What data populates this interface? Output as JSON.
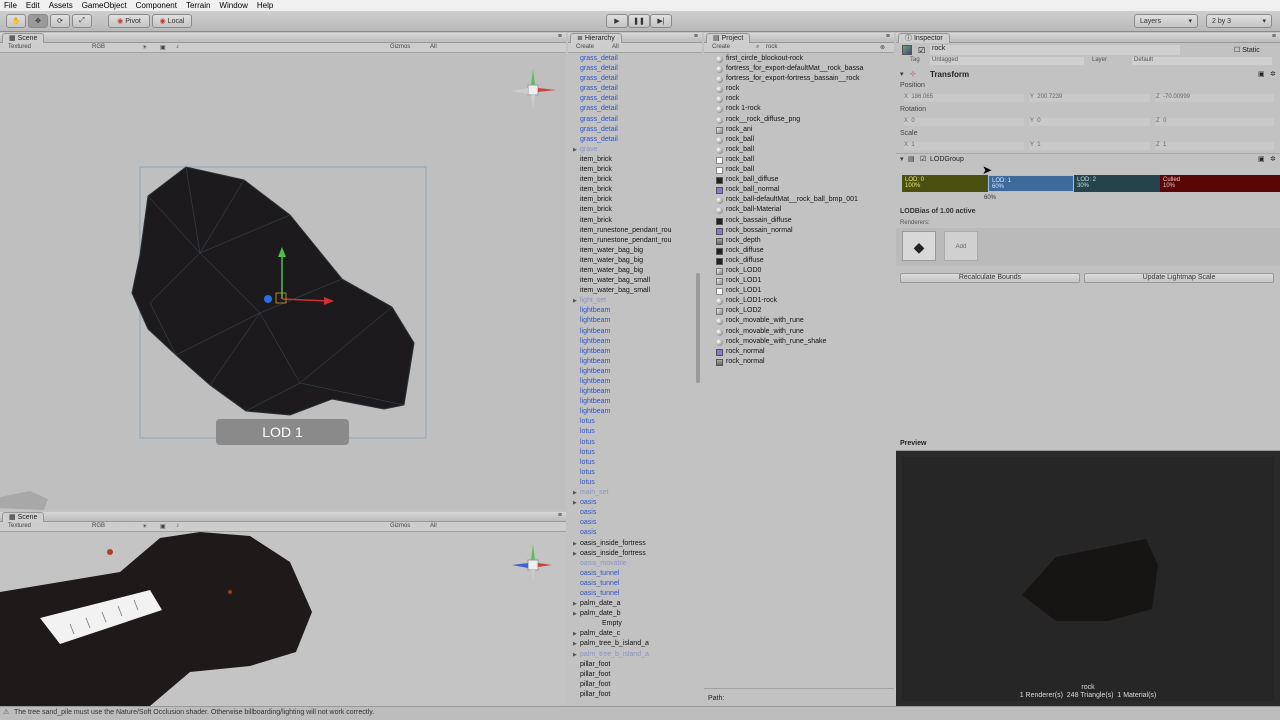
{
  "menubar": [
    "File",
    "Edit",
    "Assets",
    "GameObject",
    "Component",
    "Terrain",
    "Window",
    "Help"
  ],
  "toolbar": {
    "pivot": "Pivot",
    "local": "Local",
    "layers": "Layers",
    "layout": "2 by 3"
  },
  "scene_top": {
    "tab": "Scene",
    "shading": "Textured",
    "mode": "RGB",
    "gizmos": "Gizmos",
    "search": "All",
    "lod_label": "LOD 1"
  },
  "scene_bottom": {
    "tab": "Scene",
    "shading": "Textured",
    "mode": "RGB",
    "gizmos": "Gizmos",
    "search": "All"
  },
  "hierarchy": {
    "tab": "Hierarchy",
    "create": "Create",
    "search": "All",
    "items": [
      {
        "t": "grass_detail",
        "k": "prefab"
      },
      {
        "t": "grass_detail",
        "k": "prefab"
      },
      {
        "t": "grass_detail",
        "k": "prefab"
      },
      {
        "t": "grass_detail",
        "k": "prefab"
      },
      {
        "t": "grass_detail",
        "k": "prefab"
      },
      {
        "t": "grass_detail",
        "k": "prefab"
      },
      {
        "t": "grass_detail",
        "k": "prefab"
      },
      {
        "t": "grass_detail",
        "k": "prefab"
      },
      {
        "t": "grass_detail",
        "k": "prefab"
      },
      {
        "t": "grave",
        "k": "dim",
        "tri": true
      },
      {
        "t": "item_brick",
        "k": "n"
      },
      {
        "t": "item_brick",
        "k": "n"
      },
      {
        "t": "item_brick",
        "k": "n"
      },
      {
        "t": "item_brick",
        "k": "n"
      },
      {
        "t": "item_brick",
        "k": "n"
      },
      {
        "t": "item_brick",
        "k": "n"
      },
      {
        "t": "item_brick",
        "k": "n"
      },
      {
        "t": "item_runestone_pendant_rou",
        "k": "n"
      },
      {
        "t": "item_runestone_pendant_rou",
        "k": "n"
      },
      {
        "t": "item_water_bag_big",
        "k": "n"
      },
      {
        "t": "item_water_bag_big",
        "k": "n"
      },
      {
        "t": "item_water_bag_big",
        "k": "n"
      },
      {
        "t": "item_water_bag_small",
        "k": "n"
      },
      {
        "t": "item_water_bag_small",
        "k": "n"
      },
      {
        "t": "light_set",
        "k": "dim",
        "tri": true
      },
      {
        "t": "lightbeam",
        "k": "prefab"
      },
      {
        "t": "lightbeam",
        "k": "prefab"
      },
      {
        "t": "lightbeam",
        "k": "prefab"
      },
      {
        "t": "lightbeam",
        "k": "prefab"
      },
      {
        "t": "lightbeam",
        "k": "prefab"
      },
      {
        "t": "lightbeam",
        "k": "prefab"
      },
      {
        "t": "lightbeam",
        "k": "prefab"
      },
      {
        "t": "lightbeam",
        "k": "prefab"
      },
      {
        "t": "lightbeam",
        "k": "prefab"
      },
      {
        "t": "lightbeam",
        "k": "prefab"
      },
      {
        "t": "lightbeam",
        "k": "prefab"
      },
      {
        "t": "lotus",
        "k": "prefab"
      },
      {
        "t": "lotus",
        "k": "prefab"
      },
      {
        "t": "lotus",
        "k": "prefab"
      },
      {
        "t": "lotus",
        "k": "prefab"
      },
      {
        "t": "lotus",
        "k": "prefab"
      },
      {
        "t": "lotus",
        "k": "prefab"
      },
      {
        "t": "lotus",
        "k": "prefab"
      },
      {
        "t": "main_set",
        "k": "dim",
        "tri": true
      },
      {
        "t": "oasis",
        "k": "prefab",
        "tri": true
      },
      {
        "t": "oasis",
        "k": "prefab"
      },
      {
        "t": "oasis",
        "k": "prefab"
      },
      {
        "t": "oasis",
        "k": "prefab"
      },
      {
        "t": "oasis_inside_fortress",
        "k": "n",
        "tri": true
      },
      {
        "t": "oasis_inside_fortress",
        "k": "n",
        "tri": true
      },
      {
        "t": "oasis_movable",
        "k": "dim"
      },
      {
        "t": "oasis_tunnel",
        "k": "prefab"
      },
      {
        "t": "oasis_tunnel",
        "k": "prefab"
      },
      {
        "t": "oasis_tunnel",
        "k": "prefab"
      },
      {
        "t": "palm_date_a",
        "k": "n",
        "tri": true
      },
      {
        "t": "palm_date_b",
        "k": "n",
        "tri": true
      },
      {
        "t": "Empty",
        "k": "empty"
      },
      {
        "t": "palm_date_c",
        "k": "n",
        "tri": true
      },
      {
        "t": "palm_tree_b_island_a",
        "k": "n",
        "tri": true
      },
      {
        "t": "palm_tree_b_island_a",
        "k": "dim",
        "tri": true
      },
      {
        "t": "pillar_foot",
        "k": "n"
      },
      {
        "t": "pillar_foot",
        "k": "n"
      },
      {
        "t": "pillar_foot",
        "k": "n"
      },
      {
        "t": "pillar_foot",
        "k": "n"
      }
    ]
  },
  "project": {
    "tab": "Project",
    "create": "Create",
    "search": "rock",
    "path_label": "Path:",
    "items": [
      {
        "t": "first_circle_blockout-rock",
        "i": "sphere"
      },
      {
        "t": "fortress_for_export-defaultMat__rock_bassa",
        "i": "sphere"
      },
      {
        "t": "fortress_for_export-fortress_bassain__rock",
        "i": "sphere"
      },
      {
        "t": "rock",
        "i": "sphere"
      },
      {
        "t": "rock",
        "i": "sphere"
      },
      {
        "t": "rock 1-rock",
        "i": "sphere"
      },
      {
        "t": "rock__rock_diffuse_png",
        "i": "sphere"
      },
      {
        "t": "rock_ani",
        "i": "mesh"
      },
      {
        "t": "rock_ball",
        "i": "sphere"
      },
      {
        "t": "rock_ball",
        "i": "sphere"
      },
      {
        "t": "rock_ball",
        "i": "tex"
      },
      {
        "t": "rock_ball",
        "i": "tex"
      },
      {
        "t": "rock_ball_diffuse",
        "i": "dark"
      },
      {
        "t": "rock_ball_normal",
        "i": "mat"
      },
      {
        "t": "rock_ball-defaultMat__rock_ball_bmp_001",
        "i": "sphere"
      },
      {
        "t": "rock_ball-Material",
        "i": "sphere"
      },
      {
        "t": "rock_bassain_diffuse",
        "i": "dark"
      },
      {
        "t": "rock_bossain_normal",
        "i": "mat"
      },
      {
        "t": "rock_depth",
        "i": "depth"
      },
      {
        "t": "rock_diffuse",
        "i": "dark"
      },
      {
        "t": "rock_diffuse",
        "i": "dark"
      },
      {
        "t": "rock_LOD0",
        "i": "mesh"
      },
      {
        "t": "rock_LOD1",
        "i": "mesh"
      },
      {
        "t": "rock_LOD1",
        "i": "tex"
      },
      {
        "t": "rock_LOD1-rock",
        "i": "sphere"
      },
      {
        "t": "rock_LOD2",
        "i": "mesh"
      },
      {
        "t": "rock_movable_with_rune",
        "i": "sphere"
      },
      {
        "t": "rock_movable_with_rune",
        "i": "sphere"
      },
      {
        "t": "rock_movable_with_rune_shake",
        "i": "sphere"
      },
      {
        "t": "rock_normal",
        "i": "mat"
      },
      {
        "t": "rock_normal",
        "i": "depth"
      }
    ]
  },
  "inspector": {
    "tab": "Inspector",
    "object_name": "rock",
    "static_label": "Static",
    "tag_label": "Tag",
    "tag_value": "Untagged",
    "layer_label": "Layer",
    "layer_value": "Default",
    "transform_title": "Transform",
    "position_label": "Position",
    "position": {
      "x": "186.065",
      "y": "200.7239",
      "z": "-70.00999"
    },
    "rotation_label": "Rotation",
    "rotation": {
      "x": "0",
      "y": "0",
      "z": "0"
    },
    "scale_label": "Scale",
    "scale": {
      "x": "1",
      "y": "1",
      "z": "1"
    },
    "lodgroup_title": "LODGroup",
    "lods": [
      {
        "name": "LOD: 0",
        "pct": "100%",
        "color": "#4a4f12",
        "text": "#e6e67a"
      },
      {
        "name": "LOD: 1",
        "pct": "60%",
        "color": "#3d6a9a",
        "text": "#d6e8ff"
      },
      {
        "name": "LOD: 2",
        "pct": "30%",
        "color": "#26434c",
        "text": "#bfe0ea"
      },
      {
        "name": "Culled",
        "pct": "10%",
        "color": "#5a0606",
        "text": "#f0c0c0"
      }
    ],
    "lod_marker": "60%",
    "lodbias": "LODBias of 1.00 active",
    "renderers_label": "Renderers:",
    "add_label": "Add",
    "recalc_label": "Recalculate Bounds",
    "update_label": "Update Lightmap Scale"
  },
  "preview": {
    "title": "Preview",
    "object": "rock",
    "stats": "1 Renderer(s)  248 Triangle(s)  1 Material(s)"
  },
  "status": "The tree sand_pile must use the Nature/Soft Occlusion shader. Otherwise billboarding/lighting will not work correctly."
}
